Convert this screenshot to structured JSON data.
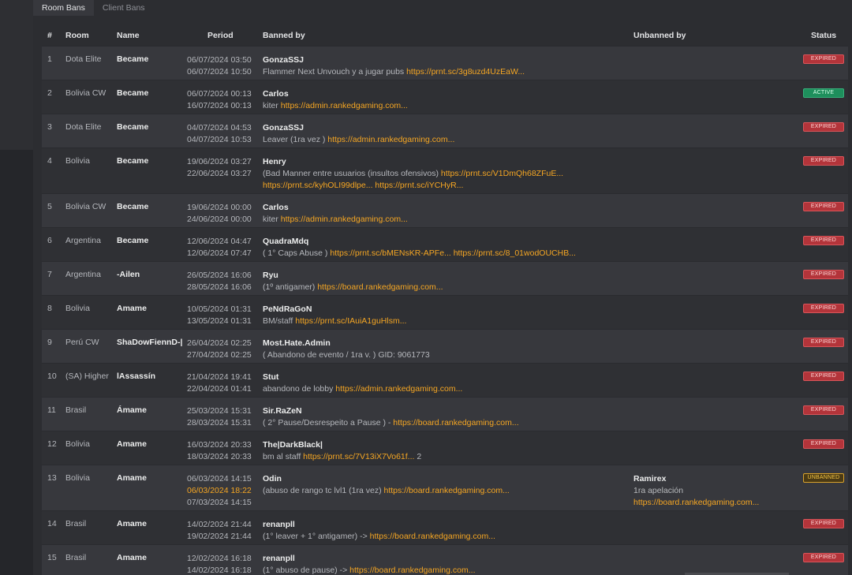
{
  "tabs": [
    {
      "label": "Room Bans",
      "active": true
    },
    {
      "label": "Client Bans",
      "active": false
    }
  ],
  "headers": {
    "num": "#",
    "room": "Room",
    "name": "Name",
    "period": "Period",
    "banned_by": "Banned by",
    "unbanned_by": "Unbanned by",
    "status": "Status"
  },
  "colors": {
    "link": "#f5a623",
    "expired": "#b3343a",
    "active": "#1e8f5c",
    "unbanned": "#d8a22b"
  },
  "rows": [
    {
      "num": "1",
      "room": "Dota Elite",
      "name": "Became",
      "period_start": "06/07/2024 03:50",
      "period_end": "06/07/2024 10:50",
      "banned_by": "GonzaSSJ",
      "lines": [
        [
          {
            "t": "Flammer Next Unvouch y a jugar pubs "
          },
          {
            "t": "https://prnt.sc/3g8uzd4UzEaW...",
            "link": true
          }
        ]
      ],
      "status": "EXPIRED",
      "status_type": "expired"
    },
    {
      "num": "2",
      "room": "Bolivia CW",
      "name": "Became",
      "period_start": "06/07/2024 00:13",
      "period_end": "16/07/2024 00:13",
      "banned_by": "Carlos",
      "lines": [
        [
          {
            "t": "kiter "
          },
          {
            "t": "https://admin.rankedgaming.com...",
            "link": true
          }
        ]
      ],
      "status": "ACTIVE",
      "status_type": "active"
    },
    {
      "num": "3",
      "room": "Dota Elite",
      "name": "Became",
      "period_start": "04/07/2024 04:53",
      "period_end": "04/07/2024 10:53",
      "banned_by": "GonzaSSJ",
      "lines": [
        [
          {
            "t": "Leaver (1ra vez ) "
          },
          {
            "t": "https://admin.rankedgaming.com...",
            "link": true
          }
        ]
      ],
      "status": "EXPIRED",
      "status_type": "expired"
    },
    {
      "num": "4",
      "room": "Bolivia",
      "name": "Became",
      "period_start": "19/06/2024 03:27",
      "period_end": "22/06/2024 03:27",
      "banned_by": "Henry",
      "lines": [
        [
          {
            "t": "(Bad Manner entre usuarios (insultos ofensivos) "
          },
          {
            "t": "https://prnt.sc/V1DmQh68ZFuE...",
            "link": true
          }
        ],
        [
          {
            "t": "https://prnt.sc/kyhOLI99dlpe...",
            "link": true
          },
          {
            "t": " "
          },
          {
            "t": "https://prnt.sc/iYCHyR...",
            "link": true
          }
        ]
      ],
      "status": "EXPIRED",
      "status_type": "expired"
    },
    {
      "num": "5",
      "room": "Bolivia CW",
      "name": "Became",
      "period_start": "19/06/2024 00:00",
      "period_end": "24/06/2024 00:00",
      "banned_by": "Carlos",
      "lines": [
        [
          {
            "t": "kiter "
          },
          {
            "t": "https://admin.rankedgaming.com...",
            "link": true
          }
        ]
      ],
      "status": "EXPIRED",
      "status_type": "expired"
    },
    {
      "num": "6",
      "room": "Argentina",
      "name": "Became",
      "period_start": "12/06/2024 04:47",
      "period_end": "12/06/2024 07:47",
      "banned_by": "QuadraMdq",
      "lines": [
        [
          {
            "t": "( 1° Caps Abuse ) "
          },
          {
            "t": "https://prnt.sc/bMENsKR-APFe...",
            "link": true
          },
          {
            "t": " "
          },
          {
            "t": "https://prnt.sc/8_01wodOUCHB...",
            "link": true
          }
        ]
      ],
      "status": "EXPIRED",
      "status_type": "expired"
    },
    {
      "num": "7",
      "room": "Argentina",
      "name": "-Ailen",
      "period_start": "26/05/2024 16:06",
      "period_end": "28/05/2024 16:06",
      "banned_by": "Ryu",
      "lines": [
        [
          {
            "t": "(1º antigamer) "
          },
          {
            "t": "https://board.rankedgaming.com...",
            "link": true
          }
        ]
      ],
      "status": "EXPIRED",
      "status_type": "expired"
    },
    {
      "num": "8",
      "room": "Bolivia",
      "name": "Amame",
      "period_start": "10/05/2024 01:31",
      "period_end": "13/05/2024 01:31",
      "banned_by": "PeNdRaGoN",
      "lines": [
        [
          {
            "t": "BM/staff "
          },
          {
            "t": "https://prnt.sc/IAuiA1guHlsm...",
            "link": true
          }
        ]
      ],
      "status": "EXPIRED",
      "status_type": "expired"
    },
    {
      "num": "9",
      "room": "Perú CW",
      "name": "ShaDowFiennD-|",
      "period_start": "26/04/2024 02:25",
      "period_end": "27/04/2024 02:25",
      "banned_by": "Most.Hate.Admin",
      "lines": [
        [
          {
            "t": "( Abandono de evento / 1ra v. ) GID: 9061773"
          }
        ]
      ],
      "status": "EXPIRED",
      "status_type": "expired"
    },
    {
      "num": "10",
      "room": "(SA) Higher",
      "name": "lAssassín",
      "period_start": "21/04/2024 19:41",
      "period_end": "22/04/2024 01:41",
      "banned_by": "Stut",
      "lines": [
        [
          {
            "t": "abandono de lobby "
          },
          {
            "t": "https://admin.rankedgaming.com...",
            "link": true
          }
        ]
      ],
      "status": "EXPIRED",
      "status_type": "expired"
    },
    {
      "num": "11",
      "room": "Brasil",
      "name": "Ámame",
      "period_start": "25/03/2024 15:31",
      "period_end": "28/03/2024 15:31",
      "banned_by": "Sir.RaZeN",
      "lines": [
        [
          {
            "t": "( 2° Pause/Desrespeito a Pause ) - "
          },
          {
            "t": "https://board.rankedgaming.com...",
            "link": true
          }
        ]
      ],
      "status": "EXPIRED",
      "status_type": "expired"
    },
    {
      "num": "12",
      "room": "Bolivia",
      "name": "Amame",
      "period_start": "16/03/2024 20:33",
      "period_end": "18/03/2024 20:33",
      "banned_by": "The|DarkBlack|",
      "lines": [
        [
          {
            "t": "bm al staff "
          },
          {
            "t": "https://prnt.sc/7V13iX7Vo61f...",
            "link": true
          },
          {
            "t": " 2"
          }
        ]
      ],
      "status": "EXPIRED",
      "status_type": "expired"
    },
    {
      "num": "13",
      "room": "Bolivia",
      "name": "Amame",
      "period_start": "06/03/2024 14:15",
      "period_mid": "06/03/2024 18:22",
      "period_end": "07/03/2024 14:15",
      "banned_by": "Odin",
      "lines": [
        [
          {
            "t": "(abuso de rango tc lvl1 (1ra vez) "
          },
          {
            "t": "https://board.rankedgaming.com...",
            "link": true
          }
        ]
      ],
      "unbanned_by": "Ramirex",
      "unban_reason": "1ra apelación",
      "unban_link": "https://board.rankedgaming.com...",
      "status": "UNBANNED",
      "status_type": "unbanned"
    },
    {
      "num": "14",
      "room": "Brasil",
      "name": "Amame",
      "period_start": "14/02/2024 21:44",
      "period_end": "19/02/2024 21:44",
      "banned_by": "renanpll",
      "lines": [
        [
          {
            "t": "(1° leaver + 1° antigamer) -> "
          },
          {
            "t": "https://board.rankedgaming.com...",
            "link": true
          }
        ]
      ],
      "status": "EXPIRED",
      "status_type": "expired"
    },
    {
      "num": "15",
      "room": "Brasil",
      "name": "Amame",
      "period_start": "12/02/2024 16:18",
      "period_end": "14/02/2024 16:18",
      "banned_by": "renanpll",
      "lines": [
        [
          {
            "t": "(1° abuso de pause) -> "
          },
          {
            "t": "https://board.rankedgaming.com...",
            "link": true
          }
        ]
      ],
      "status": "EXPIRED",
      "status_type": "expired"
    }
  ]
}
